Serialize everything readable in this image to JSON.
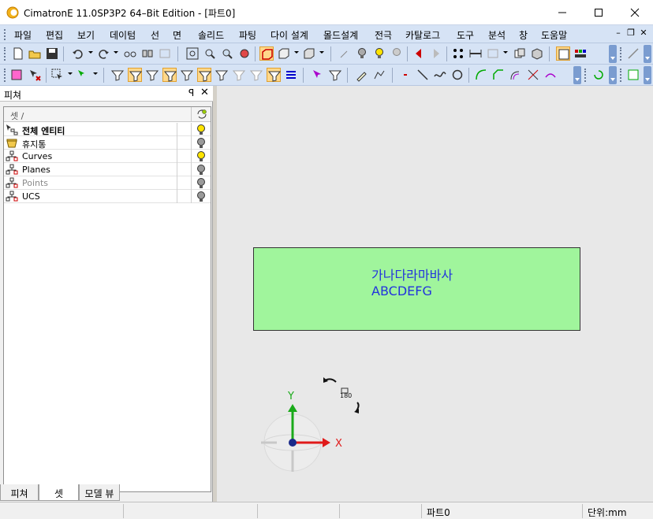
{
  "window": {
    "title": "CimatronE 11.0SP3P2 64–Bit Edition - [파트0]",
    "minimize_icon": "minimize-icon",
    "maximize_icon": "maximize-icon",
    "close_icon": "close-icon"
  },
  "menubar": {
    "items": [
      "파일",
      "편집",
      "보기",
      "데이텀",
      "선",
      "면",
      "솔리드",
      "파팅",
      "다이 설계",
      "몰드설계",
      "전극",
      "카탈로그",
      "도구",
      "분석",
      "창",
      "도움말"
    ]
  },
  "panel": {
    "title": "피쳐",
    "pin_glyph": "ꟼ",
    "close_glyph": "✕",
    "column_name": "셋 /",
    "rows": [
      {
        "label": "전체 엔티티",
        "bold": true,
        "dim": false,
        "bulb": "on"
      },
      {
        "label": "휴지통",
        "bold": false,
        "dim": false,
        "bulb": "off"
      },
      {
        "label": "Curves",
        "bold": false,
        "dim": false,
        "bulb": "on"
      },
      {
        "label": "Planes",
        "bold": false,
        "dim": false,
        "bulb": "off"
      },
      {
        "label": "Points",
        "bold": false,
        "dim": true,
        "bulb": "off"
      },
      {
        "label": "UCS",
        "bold": false,
        "dim": false,
        "bulb": "off"
      }
    ],
    "tabs": [
      "피쳐",
      "셋",
      "모델 뷰"
    ],
    "selected_tab": "셋"
  },
  "viewport": {
    "note_lines": [
      "가나다라마바사",
      "ABCDEFG"
    ],
    "note_color": "#a0f59c",
    "text_color": "#2233dd",
    "axis_x_label": "X",
    "axis_y_label": "Y",
    "rotate_label": "180"
  },
  "statusbar": {
    "part": "파트0",
    "units": "단위:mm"
  }
}
